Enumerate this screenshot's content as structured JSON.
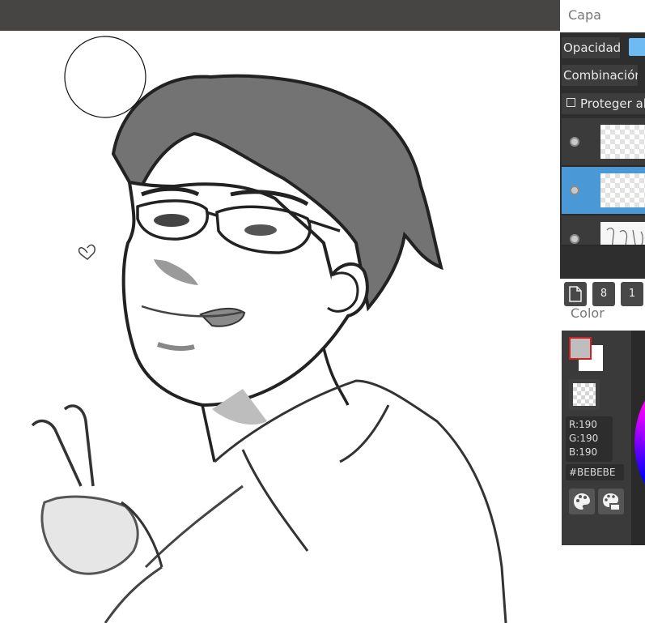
{
  "layer_panel": {
    "title": "Capa",
    "opacity_label": "Opacidad",
    "blend_label": "Combinación",
    "protect_alpha_label": "Proteger al",
    "layers": [
      {
        "name": "layer-1",
        "active": false
      },
      {
        "name": "layer-2",
        "active": true
      },
      {
        "name": "layer-3-sketch",
        "active": false
      }
    ],
    "tool_buttons": [
      {
        "name": "new-layer-button",
        "icon": "new-page-icon",
        "label": ""
      },
      {
        "name": "layer-8-button",
        "icon": "",
        "label": "8"
      },
      {
        "name": "layer-1-button",
        "icon": "",
        "label": "1"
      }
    ]
  },
  "color_panel": {
    "title": "Color",
    "foreground": "#BEBEBE",
    "background": "#FFFFFF",
    "r_label": "R:190",
    "g_label": "G:190",
    "b_label": "B:190",
    "hex_label": "#BEBEBE",
    "palette_buttons": [
      {
        "name": "palette-button",
        "icon": "palette-icon"
      },
      {
        "name": "palette-edit-button",
        "icon": "palette-edit-icon"
      }
    ]
  },
  "colors": {
    "topbar": "#474544",
    "accent": "#4A99D6",
    "panel_dark": "#2E2E2E"
  }
}
